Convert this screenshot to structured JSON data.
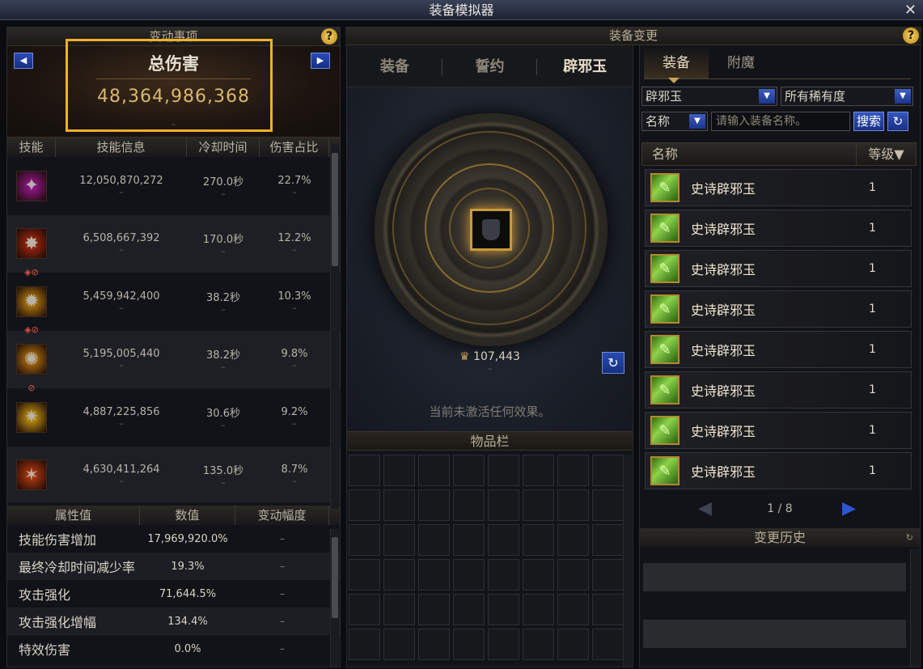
{
  "window": {
    "title": "装备模拟器",
    "close_symbol": "✕"
  },
  "left": {
    "header": "变动事项",
    "help": "?",
    "total_damage_label": "总伤害",
    "total_damage_value": "48,364,986,368",
    "total_damage_change": "–",
    "prev_symbol": "◀",
    "next_symbol": "▶",
    "columns": [
      "技能",
      "技能信息",
      "冷却时间",
      "伤害占比"
    ],
    "skills": [
      {
        "damage": "12,050,870,272",
        "cooldown": "270.0秒",
        "ratio": "22.7%",
        "icon": "demon-skill-icon",
        "glyph": "✦",
        "color": "#a0189a",
        "badge": ""
      },
      {
        "damage": "6,508,667,392",
        "cooldown": "170.0秒",
        "ratio": "12.2%",
        "icon": "fire-claw-skill-icon",
        "glyph": "✸",
        "color": "#b52a0f",
        "badge": ""
      },
      {
        "damage": "5,459,942,400",
        "cooldown": "38.2秒",
        "ratio": "10.3%",
        "icon": "flame-burst-skill-icon",
        "glyph": "✹",
        "color": "#c98c12",
        "badge": "◈⊘"
      },
      {
        "damage": "5,195,005,440",
        "cooldown": "38.2秒",
        "ratio": "9.8%",
        "icon": "flame-wave-skill-icon",
        "glyph": "✺",
        "color": "#c98012",
        "badge": "◈⊘"
      },
      {
        "damage": "4,887,225,856",
        "cooldown": "30.6秒",
        "ratio": "9.2%",
        "icon": "explosion-skill-icon",
        "glyph": "✷",
        "color": "#d4a214",
        "badge": "⊘"
      },
      {
        "damage": "4,630,411,264",
        "cooldown": "135.0秒",
        "ratio": "8.7%",
        "icon": "fire-slash-skill-icon",
        "glyph": "✶",
        "color": "#c23d10",
        "badge": ""
      }
    ],
    "attr_columns": [
      "属性值",
      "数值",
      "变动幅度"
    ],
    "attributes": [
      {
        "name": "技能伤害增加",
        "value": "17,969,920.0%",
        "change": "–"
      },
      {
        "name": "最终冷却时间减少率",
        "value": "19.3%",
        "change": "–"
      },
      {
        "name": "攻击强化",
        "value": "71,644.5%",
        "change": "–"
      },
      {
        "name": "攻击强化增幅",
        "value": "134.4%",
        "change": "–"
      },
      {
        "name": "特效伤害",
        "value": "0.0%",
        "change": "–"
      }
    ]
  },
  "middle": {
    "tabs": [
      "装备",
      "誓约",
      "辟邪玉"
    ],
    "power": "107,443",
    "power_change": "–",
    "no_effect": "当前未激活任何效果。",
    "inventory_header": "物品栏",
    "refresh_symbol": "↻"
  },
  "right": {
    "header": "装备变更",
    "help": "?",
    "tabs": [
      "装备",
      "附魔"
    ],
    "type_select": "辟邪玉",
    "rarity_select": "所有稀有度",
    "field_select": "名称",
    "search_placeholder": "请输入装备名称。",
    "search_button": "搜索",
    "list_col_name": "名称",
    "list_col_level": "等级▼",
    "items": [
      {
        "name": "史诗辟邪玉",
        "level": "1"
      },
      {
        "name": "史诗辟邪玉",
        "level": "1"
      },
      {
        "name": "史诗辟邪玉",
        "level": "1"
      },
      {
        "name": "史诗辟邪玉",
        "level": "1"
      },
      {
        "name": "史诗辟邪玉",
        "level": "1"
      },
      {
        "name": "史诗辟邪玉",
        "level": "1"
      },
      {
        "name": "史诗辟邪玉",
        "level": "1"
      },
      {
        "name": "史诗辟邪玉",
        "level": "1"
      }
    ],
    "page": "1 / 8",
    "history_header": "变更历史"
  },
  "colors": {
    "highlight": "#f2b02a",
    "gold_text": "#d9b76e",
    "blue_button": "#2a4bb0"
  }
}
